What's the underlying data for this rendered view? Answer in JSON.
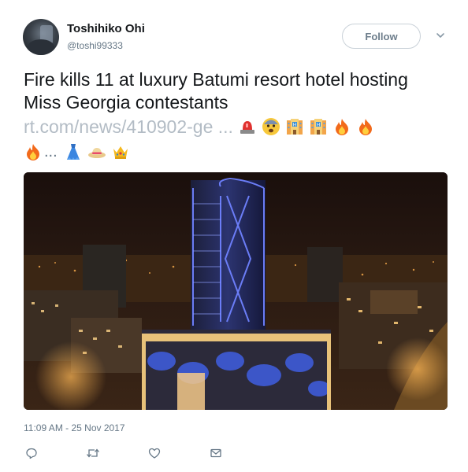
{
  "user": {
    "display_name": "Toshihiko Ohi",
    "handle": "@toshi99333"
  },
  "follow_label": "Follow",
  "tweet": {
    "text": "Fire kills 11 at luxury Batumi resort hotel hosting Miss Georgia contestants",
    "link": "rt.com/news/410902-ge ...",
    "emojis_line1": [
      "police-light-emoji",
      "fearful-face-emoji",
      "hotel-emoji",
      "hotel-emoji",
      "fire-emoji",
      "fire-emoji"
    ],
    "ellipsis": "...",
    "emojis_line2": [
      "fire-emoji",
      "dress-emoji",
      "hat-emoji",
      "crown-emoji"
    ]
  },
  "timestamp": "11:09 AM - 25 Nov 2017",
  "actions": [
    "reply-icon",
    "retweet-icon",
    "like-icon",
    "direct-message-icon"
  ],
  "colors": {
    "text": "#14171a",
    "secondary": "#657786",
    "link": "#b3bcc5",
    "border": "#c9d1d8"
  }
}
